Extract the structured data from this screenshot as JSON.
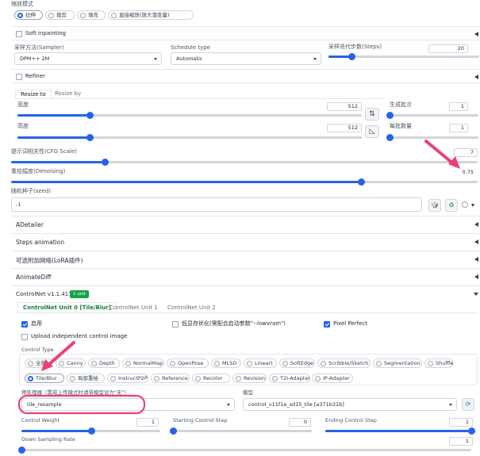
{
  "resize_mode": {
    "label": "缩放模式",
    "options": [
      "拉伸",
      "裁剪",
      "填充",
      "直接缩放(放大潜变量)"
    ],
    "selected": 0
  },
  "soft_inpainting": {
    "label": "Soft inpainting"
  },
  "sampler": {
    "label": "采样方法(Sampler)",
    "value": "DPM++ 2M"
  },
  "schedule": {
    "label": "Schedule type",
    "value": "Automatic"
  },
  "steps": {
    "label": "采样迭代步数(Steps)",
    "value": "20",
    "fraction": 0.15
  },
  "refiner": {
    "label": "Refiner"
  },
  "resize_tabs": [
    "Resize to",
    "Resize by"
  ],
  "width": {
    "label": "宽度",
    "value": "512",
    "fraction": 0.21
  },
  "height": {
    "label": "高度",
    "value": "512",
    "fraction": 0.21
  },
  "batch_count": {
    "label": "生成批次",
    "value": "1",
    "fraction": 0.0
  },
  "batch_size": {
    "label": "每批数量",
    "value": "1",
    "fraction": 0.0
  },
  "cfg": {
    "label": "提示词相关性(CFG Scale)",
    "value": "7",
    "fraction": 0.2
  },
  "denoise": {
    "label": "重绘幅度(Denoising)",
    "value": "0.75",
    "fraction": 0.75
  },
  "seed": {
    "label": "随机种子(seed)",
    "value": "-1"
  },
  "accordions": {
    "adetailer": "ADetailer",
    "steps_animation": "Steps animation",
    "lora": "可选附加网络(LoRA插件)",
    "animatediff": "AnimateDiff"
  },
  "controlnet": {
    "title": "ControlNet v1.1.417",
    "badge": "1 unit",
    "tabs": [
      "ControlNet Unit 0 [Tile/Blur]",
      "ControlNet Unit 1",
      "ControlNet Unit 2"
    ],
    "enable": "启用",
    "lowvram": "低显存优化(需配合启动参数\"--lowvram\")",
    "pixel_perfect": "Pixel Perfect",
    "upload_independent": "Upload independent control image",
    "control_type_label": "Control Type",
    "control_types_row1": [
      "全部",
      "Canny",
      "Depth",
      "NormalMap",
      "OpenPose",
      "MLSD",
      "Lineart",
      "SoftEdge",
      "Scribble/Sketch",
      "Segmentation",
      "Shuffle"
    ],
    "control_types_row2": [
      "Tile/Blur",
      "局部重绘",
      "InstructP2P",
      "Reference",
      "Recolor",
      "Revision",
      "T2I-Adapter",
      "IP-Adapter"
    ],
    "selected_type": "Tile/Blur",
    "preprocessor_label": "预处理器（置成上传模式时请将模型设为\"无\"）",
    "preprocessor_value": "tile_resample",
    "model_label": "模型",
    "model_value": "control_v11f1e_sd15_tile [a371b31b]",
    "weight": {
      "label": "Control Weight",
      "value": "1",
      "fraction": 0.5
    },
    "start": {
      "label": "Starting Control Step",
      "value": "0",
      "fraction": 0.0
    },
    "end": {
      "label": "Ending Control Step",
      "value": "1",
      "fraction": 1.0
    },
    "downsample": {
      "label": "Down Sampling Rate",
      "value": "1",
      "fraction": 0.0
    }
  },
  "colors": {
    "accent": "#2563eb",
    "annotation": "#ec4079",
    "badge": "#16a34a"
  }
}
